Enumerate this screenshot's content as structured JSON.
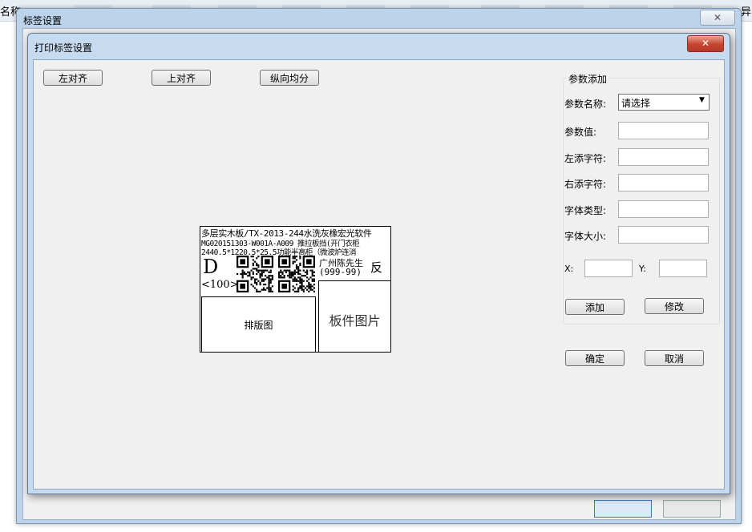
{
  "background": {
    "left_label": "名称",
    "right_label": "异"
  },
  "outer_window": {
    "title": "标签设置",
    "close_glyph": "✕"
  },
  "inner_window": {
    "title": "打印标签设置",
    "close_glyph": "✕"
  },
  "toolbar": {
    "align_left": "左对齐",
    "align_top": "上对齐",
    "distribute_vertical": "纵向均分"
  },
  "param_panel": {
    "group_title": "参数添加",
    "name_label": "参数名称:",
    "name_select_value": "请选择",
    "value_label": "参数值:",
    "left_char_label": "左添字符:",
    "right_char_label": "右添字符:",
    "font_type_label": "字体类型:",
    "font_size_label": "字体大小:",
    "x_label": "X:",
    "y_label": "Y:",
    "add_button": "添加",
    "modify_button": "修改"
  },
  "footer_buttons": {
    "ok": "确定",
    "cancel": "取消"
  },
  "label_preview": {
    "line1": "多层实木板/TX-2013-244水洗灰橡宏光软件",
    "line2": "MG020151303-W001A-A009 推拉板挡(开门衣柜",
    "line3": "2440.5*1220.5*25.5功能半高柜（微波炉连消",
    "big_letter": "D",
    "count": "<100>",
    "customer": "广州陈先生",
    "phone": "(999-99)",
    "side": "反",
    "layout_label": "排版图",
    "part_image_label": "板件图片"
  },
  "icons": {
    "select_arrow": "▼"
  }
}
